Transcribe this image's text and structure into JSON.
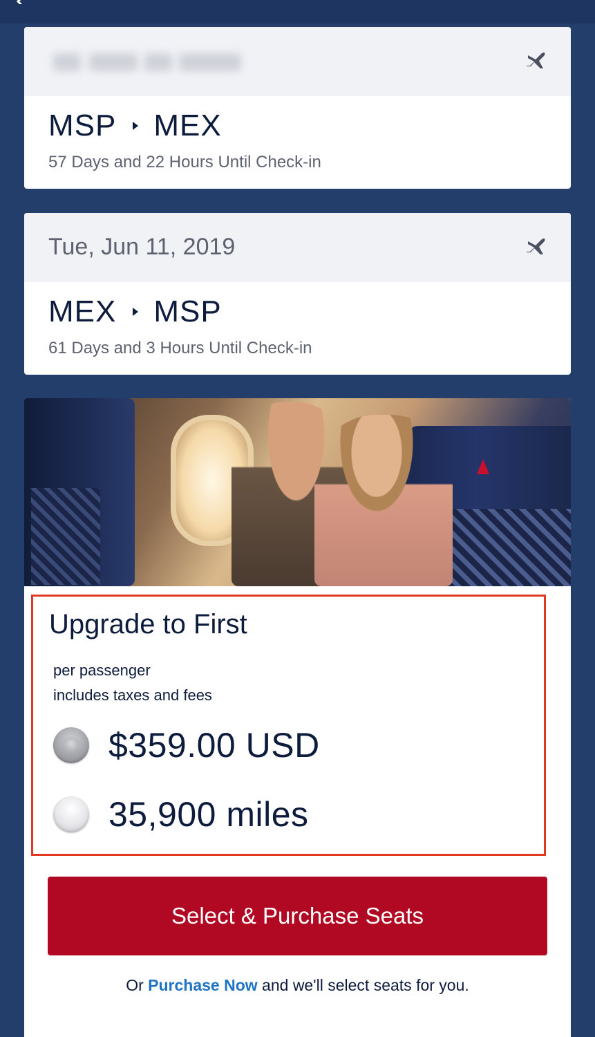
{
  "flights": [
    {
      "date": "",
      "origin": "MSP",
      "destination": "MEX",
      "checkin": "57 Days and 22 Hours Until Check-in"
    },
    {
      "date": "Tue, Jun 11, 2019",
      "origin": "MEX",
      "destination": "MSP",
      "checkin": "61 Days and 3 Hours Until Check-in"
    }
  ],
  "upgrade": {
    "title": "Upgrade to First",
    "per_passenger": "per passenger",
    "taxes_note": "includes taxes and fees",
    "options": [
      {
        "label": "$359.00 USD",
        "selected": true
      },
      {
        "label": "35,900 miles",
        "selected": false
      }
    ]
  },
  "actions": {
    "purchase_label": "Select & Purchase Seats",
    "footer_prefix": "Or ",
    "footer_link": "Purchase Now",
    "footer_suffix": " and we'll select seats for you."
  },
  "colors": {
    "background": "#233e6b",
    "button": "#b10823",
    "link": "#1e73c4",
    "highlight_border": "#e0391f"
  },
  "icons": [
    "back-chevron-icon",
    "plane-icon",
    "route-arrow-icon",
    "radio-icon"
  ]
}
